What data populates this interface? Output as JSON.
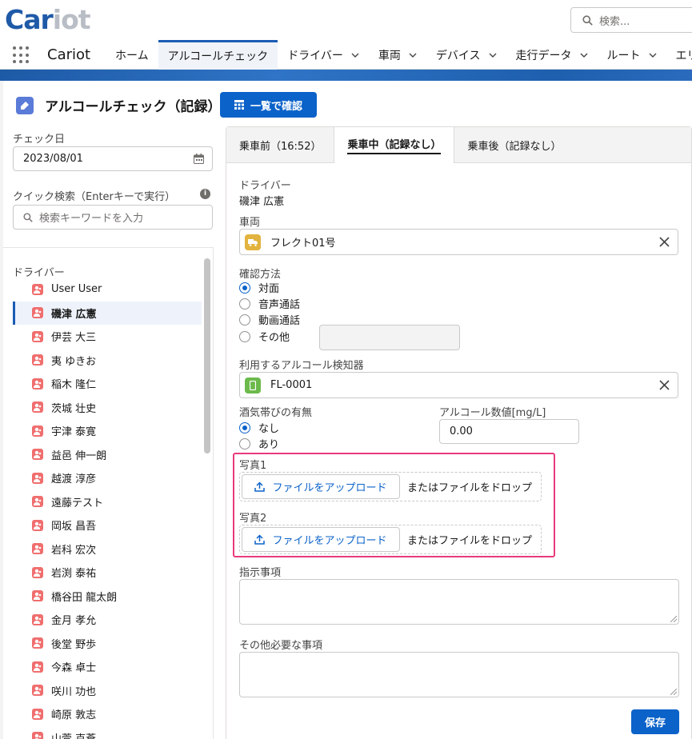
{
  "brand": {
    "logo_main": "Car",
    "logo_accent": "iot",
    "app_name": "Cariot"
  },
  "search": {
    "placeholder": "検索..."
  },
  "nav": {
    "tabs": [
      {
        "label": "ホーム",
        "has_menu": false
      },
      {
        "label": "アルコールチェック",
        "has_menu": false,
        "active": true
      },
      {
        "label": "ドライバー",
        "has_menu": true
      },
      {
        "label": "車両",
        "has_menu": true
      },
      {
        "label": "デバイス",
        "has_menu": true
      },
      {
        "label": "走行データ",
        "has_menu": true
      },
      {
        "label": "ルート",
        "has_menu": true
      },
      {
        "label": "エリ",
        "has_menu": false
      }
    ]
  },
  "page": {
    "title": "アルコールチェック（記録）",
    "list_button": "一覧で確認"
  },
  "filters": {
    "date_label": "チェック日",
    "date_value": "2023/08/01",
    "quick_search_label": "クイック検索（Enterキーで実行）",
    "quick_search_placeholder": "検索キーワードを入力"
  },
  "drivers": {
    "heading": "ドライバー",
    "items": [
      "User User",
      "磯津 広憲",
      "伊芸 大三",
      "夷 ゆきお",
      "稲木 隆仁",
      "茨城 壮史",
      "宇津 泰寛",
      "益邑 伸一朗",
      "越渡 淳彦",
      "遠藤テスト",
      "岡坂 昌吾",
      "岩科 宏次",
      "岩渕 泰祐",
      "橋谷田 龍太朗",
      "金月 孝允",
      "後堂 野歩",
      "今森 卓士",
      "咲川 功也",
      "崎原 敦志",
      "山萱 克蒼"
    ],
    "selected_index": 1
  },
  "record": {
    "tabs": [
      "乗車前（16:52）",
      "乗車中（記録なし）",
      "乗車後（記録なし）"
    ],
    "active_tab": 1,
    "driver_label": "ドライバー",
    "driver_value": "磯津 広憲",
    "vehicle_label": "車両",
    "vehicle_value": "フレクト01号",
    "method_label": "確認方法",
    "methods": [
      "対面",
      "音声通話",
      "動画通話",
      "その他"
    ],
    "method_selected": 0,
    "detector_label": "利用するアルコール検知器",
    "detector_value": "FL-0001",
    "smell_label": "酒気帯びの有無",
    "smell_options": [
      "なし",
      "あり"
    ],
    "smell_selected": 0,
    "alcohol_label": "アルコール数値[mg/L]",
    "alcohol_value": "0.00",
    "photo1_label": "写真1",
    "photo2_label": "写真2",
    "upload_label": "ファイルをアップロード",
    "drop_text": "またはファイルをドロップ",
    "instructions_label": "指示事項",
    "other_label": "その他必要な事項",
    "save_label": "保存"
  },
  "colors": {
    "brand": "#1f5aa8",
    "accent": "#0b62c9",
    "highlight": "#e83a7c",
    "driver_icon": "#f06e6e",
    "vehicle_icon": "#e2b33e",
    "detector_icon": "#6cba4c"
  },
  "icons": {
    "search": "search-icon",
    "apps": "app-launcher-icon",
    "chevron": "chevron-down-icon",
    "calendar": "calendar-icon",
    "info": "info-icon",
    "clear": "close-icon",
    "upload": "upload-icon",
    "person": "person-icon",
    "truck": "truck-icon",
    "device": "device-icon"
  }
}
